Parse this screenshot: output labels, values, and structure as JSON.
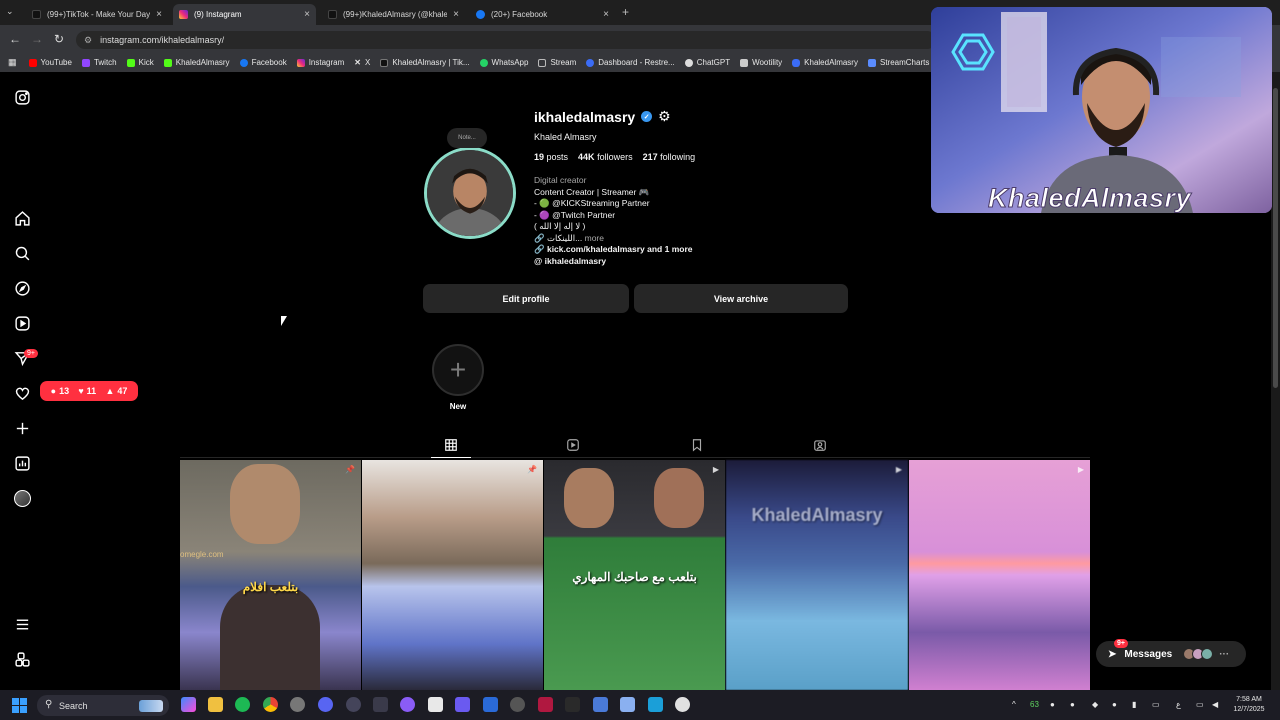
{
  "browser": {
    "tabs": [
      {
        "label": "(99+)TikTok - Make Your Day",
        "color": "#111111"
      },
      {
        "label": "(9) Instagram",
        "color": "#e1306c"
      },
      {
        "label": "(99+)KhaledAlmasry (@khaleda",
        "color": "#111111"
      },
      {
        "label": "(20+) Facebook",
        "color": "#1877f2"
      }
    ],
    "new_tab": "+",
    "url": "instagram.com/ikhaledalmasry/",
    "bookmarks": [
      {
        "label": "YouTube",
        "color": "#ff0000"
      },
      {
        "label": "Twitch",
        "color": "#9146ff"
      },
      {
        "label": "Kick",
        "color": "#53fc18"
      },
      {
        "label": "KhaledAlmasry",
        "color": "#53fc18"
      },
      {
        "label": "Facebook",
        "color": "#1877f2"
      },
      {
        "label": "Instagram",
        "color": "#e1306c"
      },
      {
        "label": "X",
        "color": "#ffffff"
      },
      {
        "label": "KhaledAlmasry | Tik...",
        "color": "#ffffff"
      },
      {
        "label": "WhatsApp",
        "color": "#25d366"
      },
      {
        "label": "Stream",
        "color": "#aaaaaa"
      },
      {
        "label": "Dashboard - Restre...",
        "color": "#3b6cf6"
      },
      {
        "label": "ChatGPT",
        "color": "#dddddd"
      },
      {
        "label": "Wootility",
        "color": "#cccccc"
      },
      {
        "label": "KhaledAlmasry",
        "color": "#3b6cf6"
      },
      {
        "label": "StreamCharts",
        "color": "#5a8cff"
      }
    ]
  },
  "sidenav": {
    "notif_badge": "9+",
    "notif_pill": {
      "comments": "13",
      "likes": "11",
      "follows": "47"
    }
  },
  "profile": {
    "note": "Note...",
    "username": "ikhaledalmasry",
    "full_name": "Khaled Almasry",
    "posts_count": "19",
    "posts_label": "posts",
    "followers_count": "44K",
    "followers_label": "followers",
    "following_count": "217",
    "following_label": "following",
    "category": "Digital creator",
    "bio_lines": [
      "Content Creator | Streamer 🎮",
      "- 🟢 @KICKStreaming Partner",
      "- 🟣 @Twitch Partner",
      "( لا إله إلا الله )",
      "🔗 اللينكات..."
    ],
    "more_label": "more",
    "link": "kick.com/khaledalmasry and 1 more",
    "threads": "ikhaledalmasry",
    "edit_button": "Edit profile",
    "archive_button": "View archive",
    "new_highlight": "New"
  },
  "posts": [
    {
      "caption": "",
      "overlay": "omegle.com"
    },
    {
      "caption": "",
      "overlay": ""
    },
    {
      "caption": "بتلعب مع صاحبك المهاري",
      "overlay": ""
    },
    {
      "caption": "",
      "overlay": "KhaledAlmasry"
    },
    {
      "caption": "",
      "overlay": ""
    },
    {
      "caption": "بتلعب افلام",
      "overlay": ""
    }
  ],
  "messages": {
    "label": "Messages",
    "badge": "9+"
  },
  "webcam": {
    "name": "KhaledAlmasry"
  },
  "taskbar": {
    "search": "Search",
    "weather": "63",
    "lang": "ع",
    "time": "7:58 AM",
    "date": "12/7/2025"
  }
}
